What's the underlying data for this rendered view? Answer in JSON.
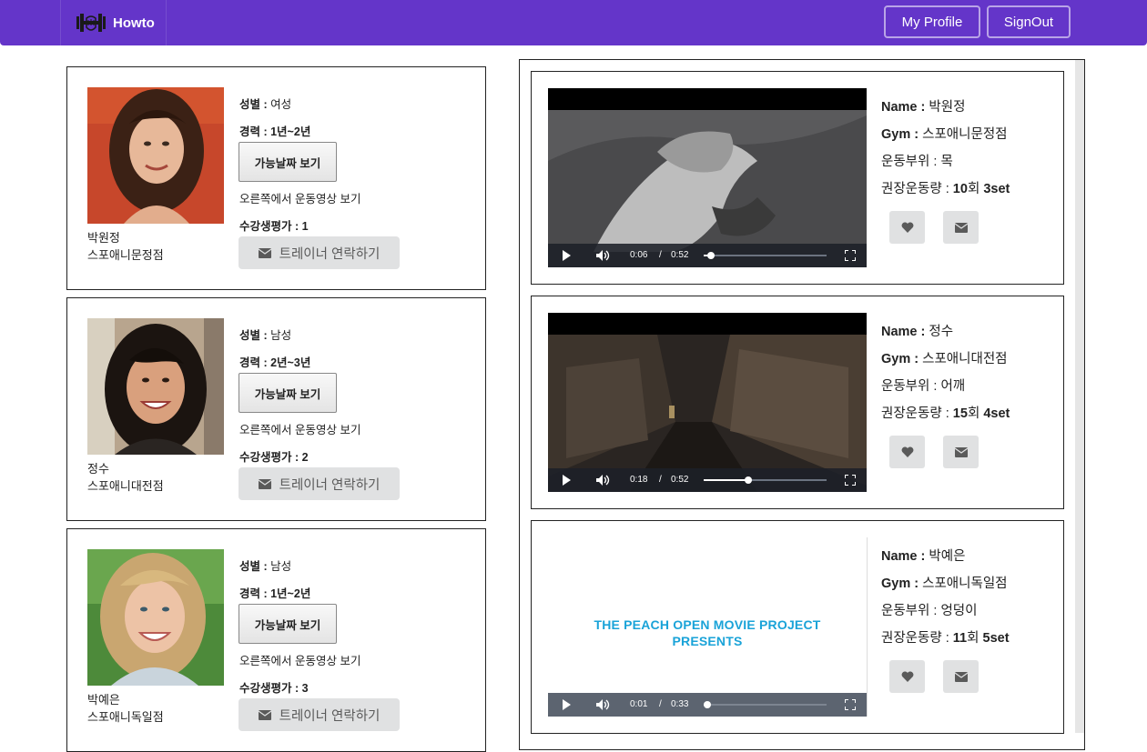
{
  "navbar": {
    "brand": "Howto",
    "buttons": {
      "profile": "My Profile",
      "signout": "SignOut"
    },
    "color": "#6435c9"
  },
  "labels": {
    "gender": "성별 : ",
    "career": "경력 : ",
    "available": "가능날짜 보기",
    "video_note": "오른쪽에서 운동영상 보기",
    "rating": "수강생평가 : ",
    "contact": "트레이너 연락하기",
    "name": "Name : ",
    "gym": "Gym : ",
    "part": "운동부위 : ",
    "amount": "권장운동량 : "
  },
  "trainers": [
    {
      "name": "박원정",
      "gym": "스포애니문정점",
      "gender": "여성",
      "career": "1년~2년",
      "rating": "1"
    },
    {
      "name": "정수",
      "gym": "스포애니대전점",
      "gender": "남성",
      "career": "2년~3년",
      "rating": "2"
    },
    {
      "name": "박예은",
      "gym": "스포애니독일점",
      "gender": "남성",
      "career": "1년~2년",
      "rating": "3"
    }
  ],
  "videos": [
    {
      "name": "박원정",
      "gym": "스포애니문정점",
      "part": "목",
      "amount_count": "10",
      "amount_unit_count": "회 ",
      "amount_set": "3set",
      "current": "0:06",
      "sep": "/",
      "duration": "0:52",
      "progress": 0.06
    },
    {
      "name": "정수",
      "gym": "스포애니대전점",
      "part": "어깨",
      "amount_count": "15",
      "amount_unit_count": "회 ",
      "amount_set": "4set",
      "current": "0:18",
      "sep": "/",
      "duration": "0:52",
      "progress": 0.36
    },
    {
      "name": "박예은",
      "gym": "스포애니독일점",
      "part": "엉덩이",
      "amount_count": "11",
      "amount_unit_count": "회 ",
      "amount_set": "5set",
      "current": "0:01",
      "sep": "/",
      "duration": "0:33",
      "progress": 0.03,
      "overlay_text_1": "THE PEACH OPEN MOVIE PROJECT",
      "overlay_text_2": "PRESENTS"
    }
  ],
  "icons": {
    "brand": "dumbbell-hand-icon",
    "contact": "envelope-icon",
    "like": "heart-icon",
    "mail": "envelope-icon",
    "play": "play-icon",
    "volume": "volume-icon",
    "fullscreen": "fullscreen-icon"
  }
}
